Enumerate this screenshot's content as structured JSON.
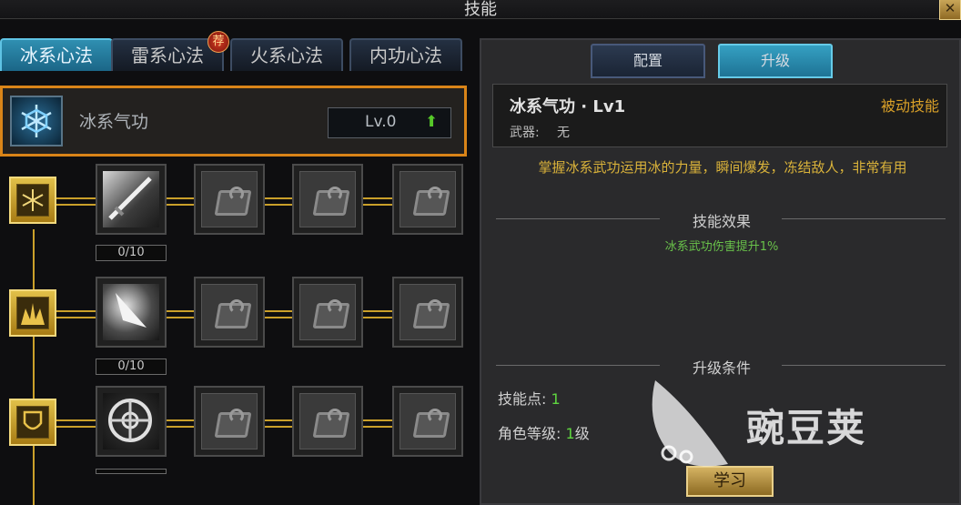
{
  "window": {
    "title": "技能",
    "close_label": "✕"
  },
  "tabs": [
    {
      "label": "冰系心法",
      "active": true
    },
    {
      "label": "雷系心法",
      "badge": "荐"
    },
    {
      "label": "火系心法"
    },
    {
      "label": "内功心法"
    }
  ],
  "skill_header": {
    "name": "冰系气功",
    "level": "Lv.0",
    "upgrade_icon": "green-up-arrow-icon"
  },
  "skill_tree": {
    "rows": [
      {
        "node_icon": "snowflake-badge-icon",
        "first_skill": "sword-skill-icon",
        "progress": "0/10"
      },
      {
        "node_icon": "flame-burst-icon",
        "first_skill": "blade-tip-skill-icon",
        "progress": "0/10"
      },
      {
        "node_icon": "shield-emblem-icon",
        "first_skill": "wheel-shield-skill-icon",
        "progress": ""
      }
    ],
    "locked_icon": "locked-book-icon"
  },
  "right_tabs": [
    {
      "label": "配置"
    },
    {
      "label": "升级",
      "active": true
    }
  ],
  "info": {
    "name": "冰系气功 · Lv1",
    "type": "被动技能",
    "weapon_label": "武器:",
    "weapon_value": "无",
    "description": "掌握冰系武功运用冰的力量，瞬间爆发，冻结敌人，非常有用",
    "effect_title": "技能效果",
    "effect_text": "冰系武功伤害提升1%",
    "condition_title": "升级条件",
    "skill_points_label": "技能点:",
    "skill_points_value": "1",
    "role_level_label": "角色等级:",
    "role_level_value": "1",
    "role_level_unit": "级",
    "learn_button": "学习"
  },
  "watermark": {
    "text": "豌豆荚"
  },
  "colors": {
    "accent_blue": "#2f8fb1",
    "highlight_orange": "#d98418",
    "gold_text": "#d9a028",
    "green_value": "#5fd640"
  }
}
